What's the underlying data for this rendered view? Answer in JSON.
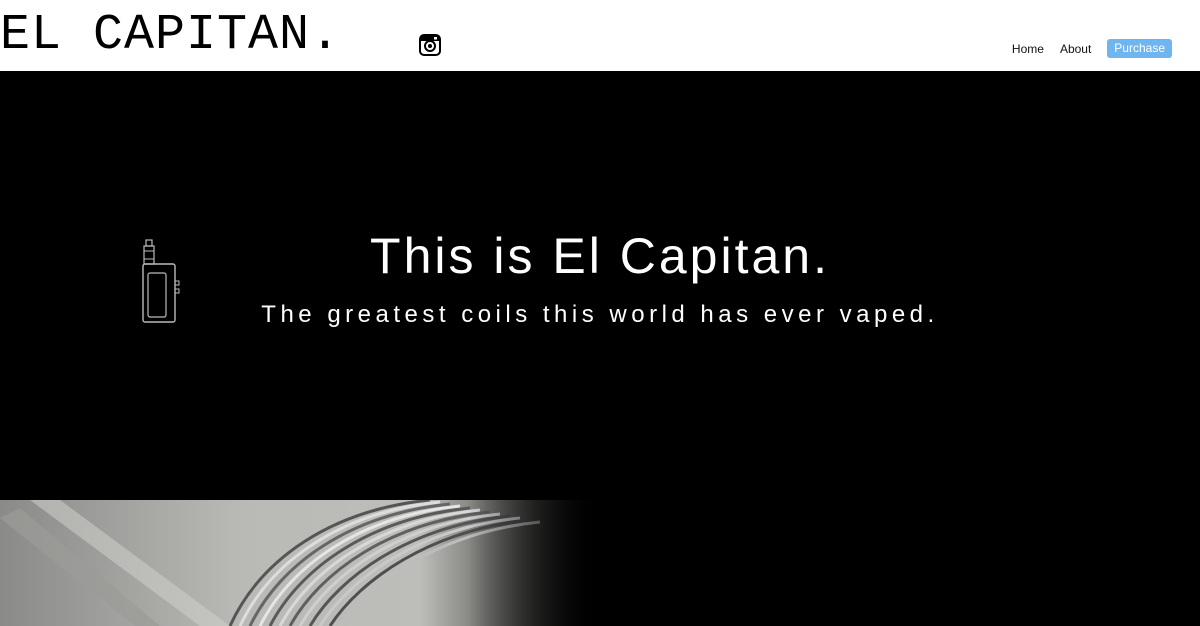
{
  "header": {
    "logo": "EL CAPITAN.",
    "instagram_icon": "instagram-icon",
    "nav": {
      "home": "Home",
      "about": "About",
      "purchase": "Purchase"
    }
  },
  "hero": {
    "icon": "vape-mod-icon",
    "title": "This is El Capitan.",
    "subtitle": "The greatest coils this world has ever vaped."
  },
  "colors": {
    "header_bg": "#ffffff",
    "hero_bg": "#000000",
    "purchase_button": "#6fb6f1"
  }
}
